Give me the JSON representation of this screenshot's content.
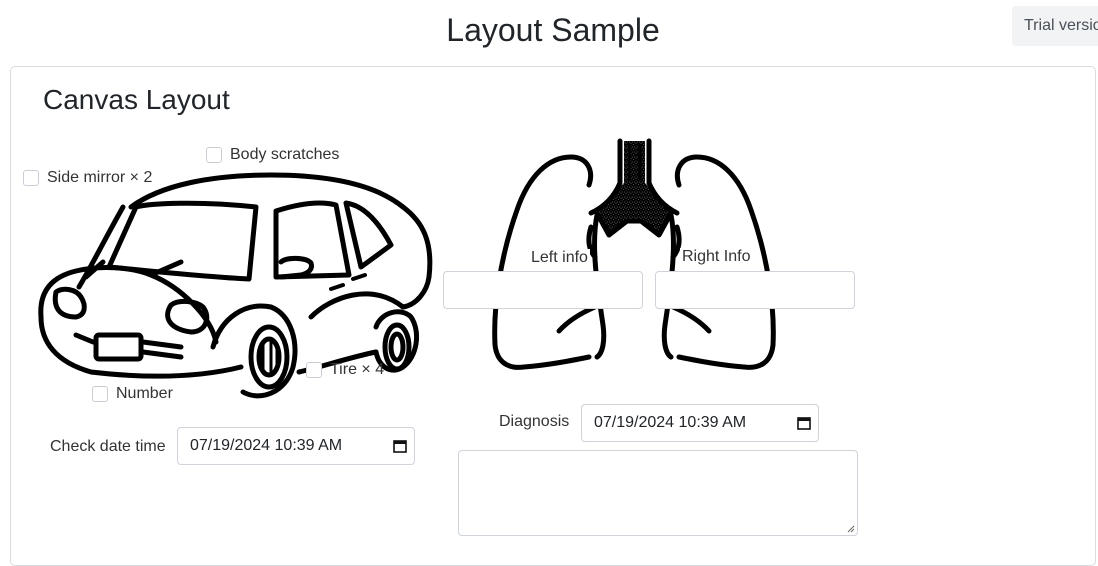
{
  "header": {
    "title": "Layout Sample",
    "trial_label": "Trial version"
  },
  "card": {
    "title": "Canvas Layout"
  },
  "car": {
    "checkboxes": {
      "side_mirror": "Side mirror × 2",
      "body_scratches": "Body scratches",
      "tire": "Tire × 4",
      "number": "Number"
    },
    "check_date_label": "Check date time",
    "check_date_value": "07/19/2024 10:39  AM"
  },
  "lungs": {
    "left_label": "Left info",
    "right_label": "Right Info",
    "left_value": "",
    "right_value": ""
  },
  "diagnosis": {
    "label": "Diagnosis",
    "date_value": "07/19/2024 10:39  AM",
    "notes_value": ""
  },
  "icons": {
    "calendar": "calendar-icon",
    "car": "car-illustration",
    "lungs": "lungs-illustration"
  }
}
